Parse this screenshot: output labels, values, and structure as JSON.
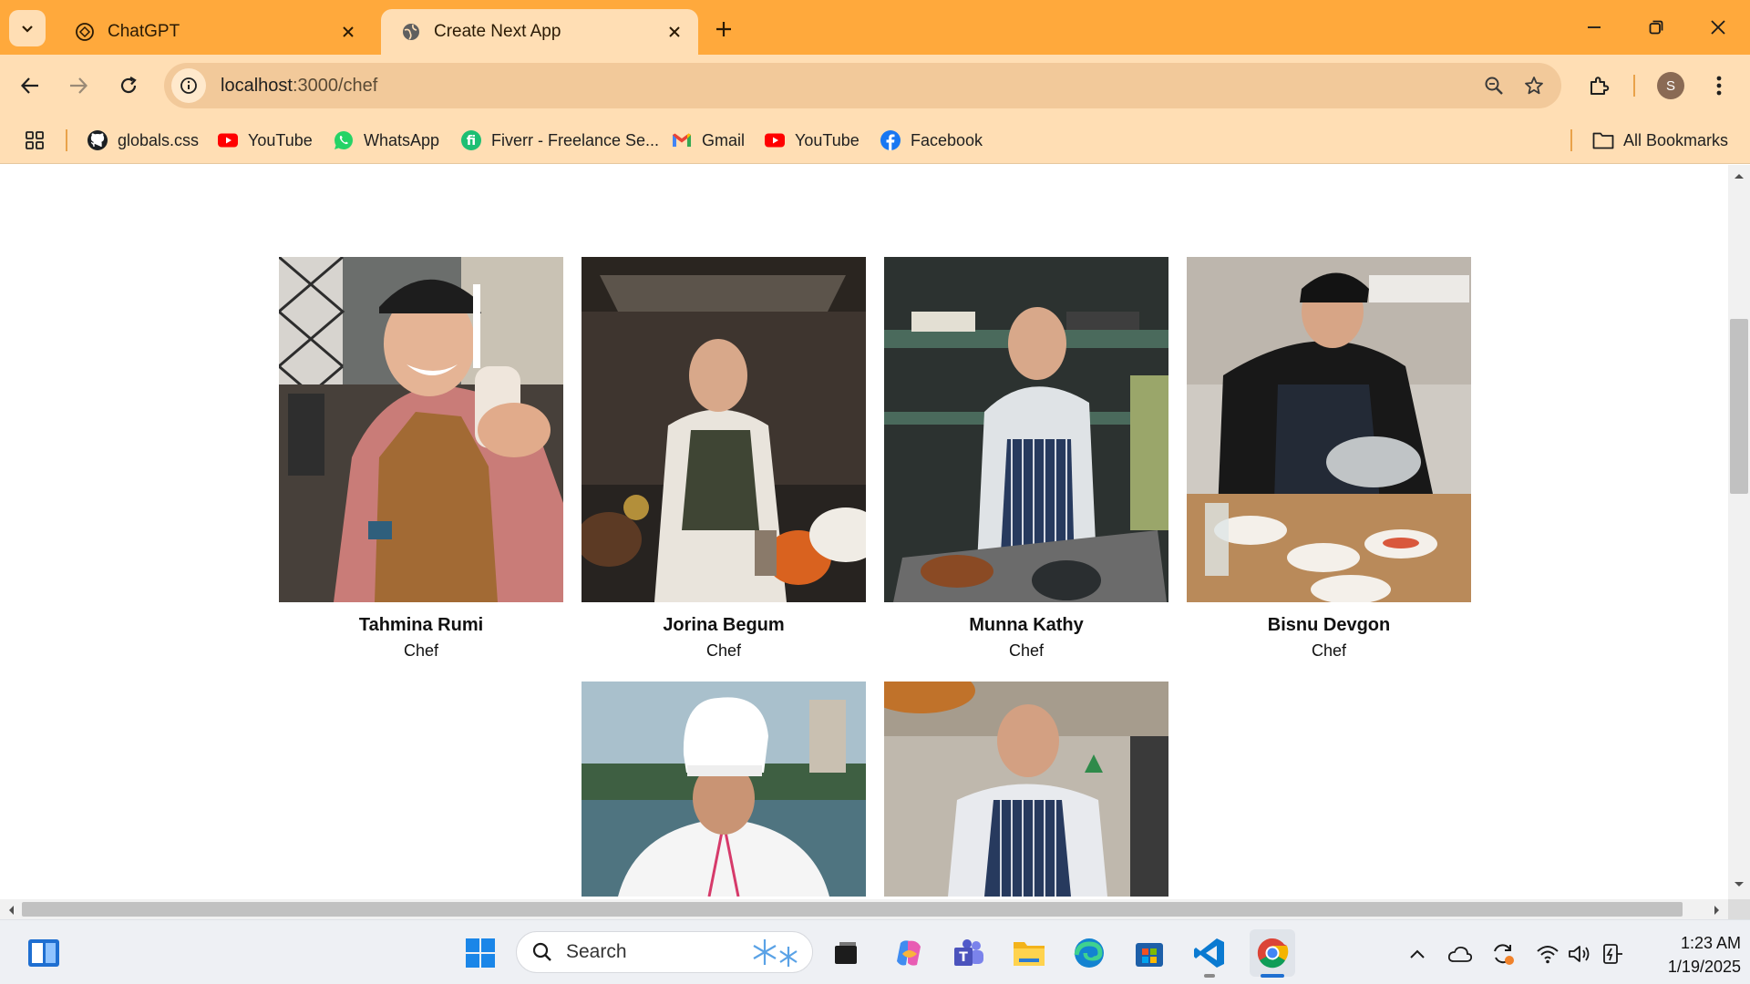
{
  "browser": {
    "tabs": [
      {
        "title": "ChatGPT",
        "active": false
      },
      {
        "title": "Create Next App",
        "active": true
      }
    ],
    "url_host": "localhost",
    "url_path": ":3000/chef",
    "profile_initial": "S",
    "bookmarks": [
      {
        "label": "globals.css",
        "icon": "github-icon"
      },
      {
        "label": "YouTube",
        "icon": "youtube-icon"
      },
      {
        "label": "WhatsApp",
        "icon": "whatsapp-icon"
      },
      {
        "label": "Fiverr - Freelance Se...",
        "icon": "fiverr-icon"
      },
      {
        "label": "Gmail",
        "icon": "gmail-icon"
      },
      {
        "label": "YouTube",
        "icon": "youtube-icon"
      },
      {
        "label": "Facebook",
        "icon": "facebook-icon"
      }
    ],
    "all_bookmarks": "All Bookmarks"
  },
  "chefs": [
    {
      "name": "Tahmina Rumi",
      "role": "Chef"
    },
    {
      "name": "Jorina Begum",
      "role": "Chef"
    },
    {
      "name": "Munna Kathy",
      "role": "Chef"
    },
    {
      "name": "Bisnu Devgon",
      "role": "Chef"
    },
    {
      "name": "",
      "role": ""
    },
    {
      "name": "",
      "role": ""
    }
  ],
  "taskbar": {
    "search_placeholder": "Search",
    "time": "1:23 AM",
    "date": "1/19/2025"
  },
  "colors": {
    "tabbar": "#FFA93C",
    "toolbar": "#FFDEB4",
    "omnibox": "#F2C99A"
  }
}
